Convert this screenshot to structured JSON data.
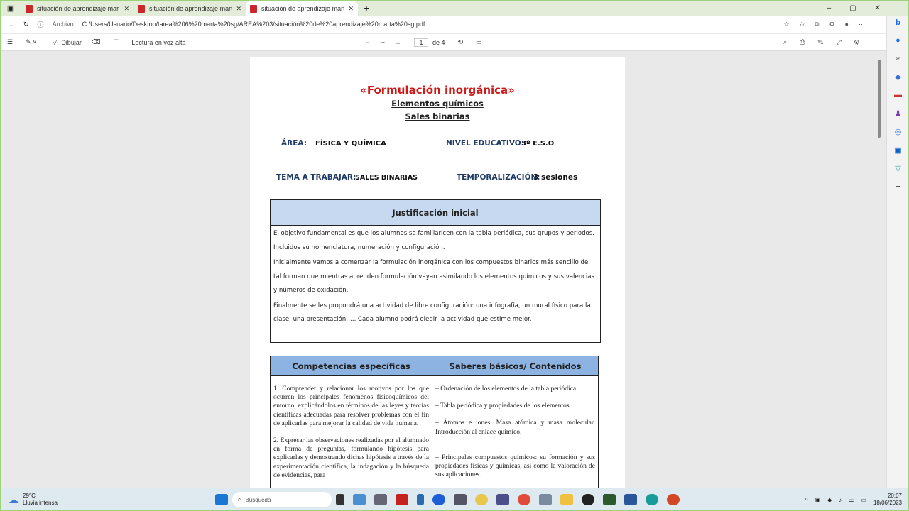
{
  "tabs": [
    {
      "title": "situación de aprendizaje marta s"
    },
    {
      "title": "situación de aprendizaje marta s"
    },
    {
      "title": "situación de aprendizaje marta s"
    }
  ],
  "address": {
    "label": "Archivo",
    "url": "C:/Users/Usuario/Desktop/tarea%206%20marta%20sg/AREA%203/situación%20de%20aprendizaje%20marta%20sg.pdf"
  },
  "pdf_toolbar": {
    "draw": "Dibujar",
    "read_aloud": "Lectura en voz alta",
    "page": "1",
    "of": "de 4"
  },
  "doc": {
    "title": "«Formulación inorgánica»",
    "subtitle1": "Elementos químicos",
    "subtitle2": "Sales binarias",
    "area_label": "ÁREA:",
    "area": "FÍSICA Y QUÍMICA",
    "nivel_label": "NIVEL EDUCATIVO:",
    "nivel": "3º E.S.O",
    "tema_label": "TEMA A TRABAJAR:",
    "tema": "SALES BINARIAS",
    "temp_label": "TEMPORALIZACIÓN:",
    "temp": "3 sesiones",
    "just_title": "Justificación inicial",
    "just": [
      "El objetivo fundamental es que los alumnos se familiaricen con la tabla periódica, sus grupos y periodos. Incluidos su nomenclatura, numeración y configuración.",
      "Inicialmente vamos a comenzar la formulación inorgánica con los compuestos binarios más sencillo de tal forman que mientras aprenden formulación vayan asimilando los elementos químicos y sus valencias y números de oxidación.",
      "Finalmente se les propondrá una actividad de libre configuración: una infografía, un mural físico para la clase, una presentación,…. Cada alumno podrá elegir la actividad que estime mejor."
    ],
    "comp_title": "Competencias específicas",
    "sab_title": "Saberes básicos/ Contenidos",
    "comp": [
      "1. Comprender y relacionar los motivos por los que ocurren los principales fenómenos fisicoquímicos del entorno, explicándolos en términos de las leyes y teorías científicas adecuadas para resolver problemas con el fin de aplicarlas para mejorar la calidad de vida humana.",
      "2. Expresar las observaciones realizadas por el alumnado en forma de preguntas, formulando hipótesis para explicarlas y demostrando dichas hipótesis a través de la experimentación científica, la indagación y la búsqueda de evidencias, para"
    ],
    "sab": [
      "– Ordenación de los elementos de la tabla periódica.",
      "– Tabla periódica y propiedades de los elementos.",
      "– Átomos e iones. Masa atómica y masa molecular. Introducción al enlace químico.",
      "– Principales compuestos químicos: su formación y sus propiedades físicas y químicas, así como la valoración de sus aplicaciones."
    ]
  },
  "taskbar": {
    "temp": "29°C",
    "weather": "Lluvia intensa",
    "search": "Búsqueda",
    "time": "20:07",
    "date": "18/06/2023"
  }
}
